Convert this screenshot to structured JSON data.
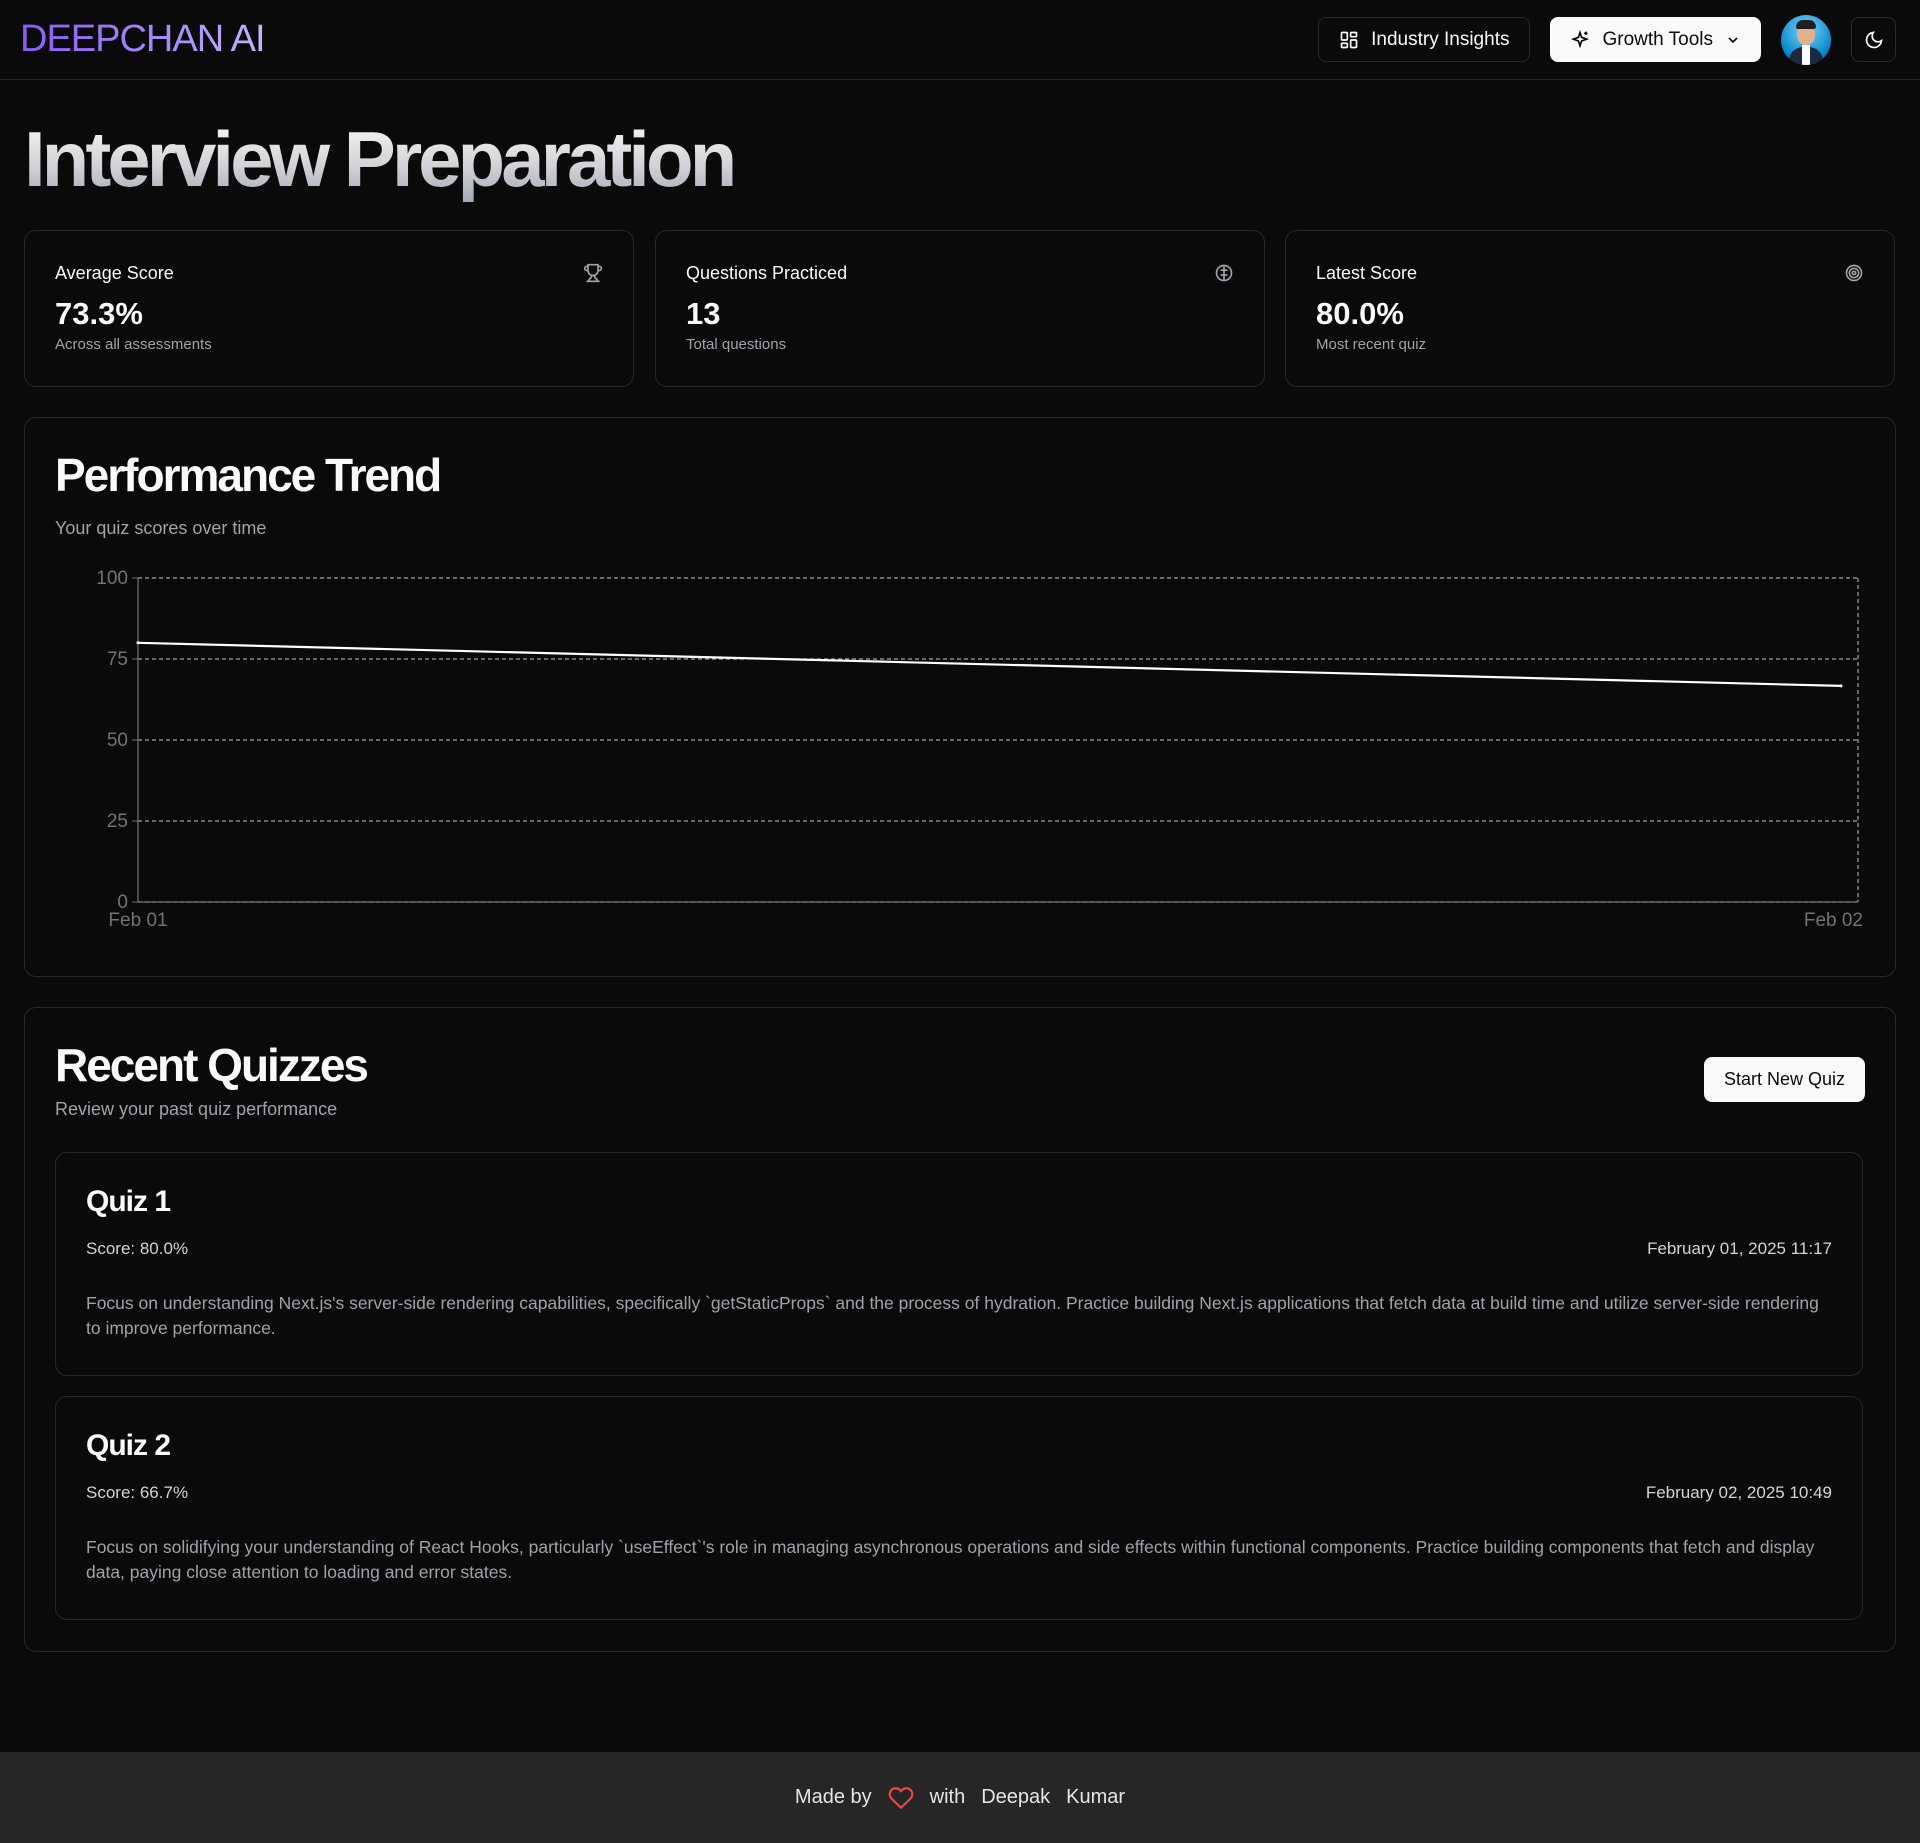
{
  "header": {
    "logo": "DEEPCHAN AI",
    "industry_insights": "Industry Insights",
    "growth_tools": "Growth Tools"
  },
  "page": {
    "title": "Interview Preparation"
  },
  "stats": [
    {
      "label": "Average Score",
      "value": "73.3%",
      "sub": "Across all assessments",
      "icon": "trophy-icon"
    },
    {
      "label": "Questions Practiced",
      "value": "13",
      "sub": "Total questions",
      "icon": "brain-icon"
    },
    {
      "label": "Latest Score",
      "value": "80.0%",
      "sub": "Most recent quiz",
      "icon": "target-icon"
    }
  ],
  "trend": {
    "title": "Performance Trend",
    "subtitle": "Your quiz scores over time"
  },
  "chart_data": {
    "type": "line",
    "x": [
      "Feb 01",
      "Feb 02"
    ],
    "series": [
      {
        "values": [
          80.0,
          66.7
        ]
      }
    ],
    "ylim": [
      0,
      100
    ],
    "yticks": [
      0,
      25,
      50,
      75,
      100
    ],
    "grid": true
  },
  "recent": {
    "title": "Recent Quizzes",
    "subtitle": "Review your past quiz performance",
    "start_button": "Start New Quiz",
    "quizzes": [
      {
        "title": "Quiz 1",
        "score": "Score: 80.0%",
        "date": "February 01, 2025 11:17",
        "description": "Focus on understanding Next.js's server-side rendering capabilities, specifically `getStaticProps` and the process of hydration. Practice building Next.js applications that fetch data at build time and utilize server-side rendering to improve performance."
      },
      {
        "title": "Quiz 2",
        "score": "Score: 66.7%",
        "date": "February 02, 2025 10:49",
        "description": "Focus on solidifying your understanding of React Hooks, particularly `useEffect`'s role in managing asynchronous operations and side effects within functional components. Practice building components that fetch and display data, paying close attention to loading and error states."
      }
    ]
  },
  "footer": {
    "made_by": "Made by",
    "with": "with",
    "first_name": "Deepak",
    "last_name": "Kumar"
  },
  "colors": {
    "background": "#0a0a0a",
    "border": "#262626",
    "logo_accent": "#8b5cf6",
    "heart": "#ef4444",
    "footer_bg": "#262626"
  }
}
